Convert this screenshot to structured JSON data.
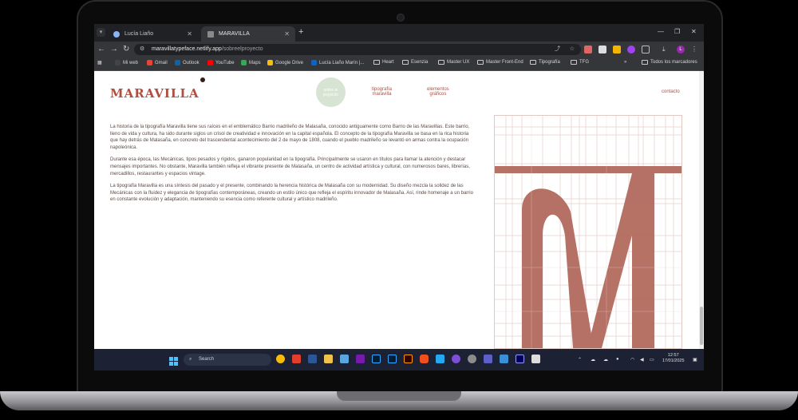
{
  "browser": {
    "tabs": [
      {
        "title": "Lucía Liaño",
        "active": false
      },
      {
        "title": "MARAVILLA",
        "active": true
      }
    ],
    "url_host": "maravillatypeface.netlify.app",
    "url_path": "/sobreelproyecto",
    "bookmarks": [
      "Mi web",
      "Gmail",
      "Outlook",
      "YouTube",
      "Maps",
      "Google Drive",
      "Lucía Liaño Marín |...",
      "Heart",
      "Esenzia",
      "Master UX",
      "Master Front-End",
      "Tipografía",
      "TFG"
    ],
    "all_bookmarks": "Todos los marcadores",
    "profile_initial": "L"
  },
  "site": {
    "logo": "MARAVILLA",
    "nav": [
      {
        "label_line1": "sobre el",
        "label_line2": "proyecto",
        "active": true
      },
      {
        "label_line1": "tipografía",
        "label_line2": "maravilla",
        "active": false
      },
      {
        "label_line1": "elementos",
        "label_line2": "gráficos",
        "active": false
      },
      {
        "label_line1": "contacto",
        "label_line2": "",
        "active": false
      }
    ],
    "paragraphs": [
      "La historia de la tipografía Maravilla tiene sus raíces en el emblemático Barrio madrileño de Malasaña, conocido antiguamente como Barrio de las Maravillas. Este barrio, lleno de vida y cultura, ha sido durante siglos un crisol de creatividad e innovación en la capital española. El concepto de la tipografía Maravilla se basa en la rica historia que hay detrás de Malasaña, en concreto del trascendental acontecimiento del 2 de mayo de 1808, cuando el pueblo madrileño se levantó en armas contra la ocupación napoleónica.",
      "Durante esa época, las Mecánicas, tipos pesados y rígidos, ganaron popularidad en la tipografía. Principalmente se usaron en títulos para llamar la atención y destacar mensajes importantes. No obstante, Maravilla también refleja el vibrante presente de Malasaña, un centro de actividad artística y cultural, con numerosos bares, librerías, mercadillos, restaurantes y espacios vintage.",
      "La tipografía Maravilla es una síntesis del pasado y el presente, combinando la herencia histórica de Malasaña con su modernidad. Su diseño mezcla la solidez de las Mecánicas con la fluidez y elegancia de tipografías contemporáneas, creando un estilo único que refleja el espíritu innovador de Malasaña. Así, rinde homenaje a un barrio en constante evolución y adaptación, manteniendo su esencia como referente cultural y artístico madrileño."
    ],
    "glyph": "M",
    "colors": {
      "accent": "#b04f41",
      "glyph": "#b36a5e",
      "pill": "#d7e4d3"
    }
  },
  "taskbar": {
    "search_label": "Search",
    "time": "12:57",
    "date": "17/01/2025"
  }
}
